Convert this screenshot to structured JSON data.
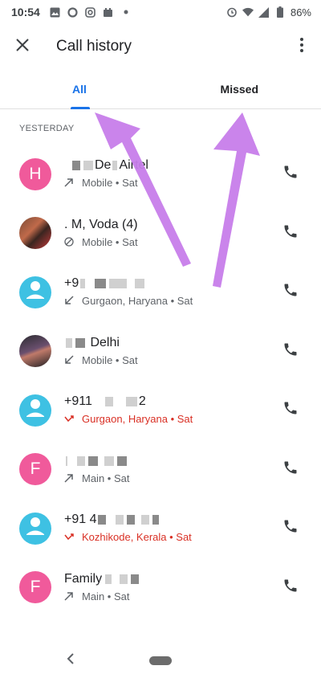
{
  "status_bar": {
    "time": "10:54",
    "battery": "86%",
    "icons_left": [
      "image-icon",
      "circle-o-icon",
      "instagram-icon",
      "cast-icon",
      "dot-icon"
    ],
    "icons_right": [
      "alarm-icon",
      "wifi-icon",
      "signal-icon",
      "battery-icon"
    ]
  },
  "app_bar": {
    "title": "Call history",
    "close_icon": "close-icon",
    "menu_icon": "more-vert-icon"
  },
  "tabs": [
    {
      "label": "All",
      "active": true
    },
    {
      "label": "Missed",
      "active": false
    }
  ],
  "colors": {
    "accent": "#1a73e8",
    "missed": "#d93025",
    "avatar_pink": "#f05a9b",
    "avatar_cyan": "#3ec1e3",
    "arrow": "#c77dea"
  },
  "section": {
    "header": "YESTERDAY"
  },
  "calls": [
    {
      "avatar_letter": "H",
      "avatar_type": "pink",
      "name": "Airtel",
      "name_prefix": "De",
      "detail": "Mobile • Sat",
      "direction": "outgoing",
      "missed": false
    },
    {
      "avatar_letter": "",
      "avatar_type": "photo",
      "name": ". M, Voda (4)",
      "name_prefix": "",
      "detail": "Mobile • Sat",
      "direction": "blocked",
      "missed": false
    },
    {
      "avatar_letter": "",
      "avatar_type": "person",
      "name": "+9",
      "name_prefix": "",
      "detail": "Gurgaon, Haryana • Sat",
      "direction": "incoming",
      "missed": false
    },
    {
      "avatar_letter": "",
      "avatar_type": "photo2",
      "name": "Delhi",
      "name_prefix": "",
      "detail": "Mobile • Sat",
      "direction": "incoming",
      "missed": false
    },
    {
      "avatar_letter": "",
      "avatar_type": "person",
      "name": "+911",
      "name_suffix": "2",
      "detail": "Gurgaon, Haryana • Sat",
      "direction": "missed",
      "missed": true
    },
    {
      "avatar_letter": "F",
      "avatar_type": "pink",
      "name": "",
      "name_prefix": "",
      "detail": "Main • Sat",
      "direction": "outgoing",
      "missed": false
    },
    {
      "avatar_letter": "",
      "avatar_type": "person",
      "name": "+91 4",
      "name_prefix": "",
      "detail": "Kozhikode, Kerala • Sat",
      "direction": "missed",
      "missed": true
    },
    {
      "avatar_letter": "F",
      "avatar_type": "pink",
      "name": "Family",
      "name_prefix": "",
      "detail": "Main • Sat",
      "direction": "outgoing",
      "missed": false
    }
  ],
  "nav_bar": {
    "back_icon": "back-chevron-icon",
    "home_icon": "home-pill-icon"
  }
}
